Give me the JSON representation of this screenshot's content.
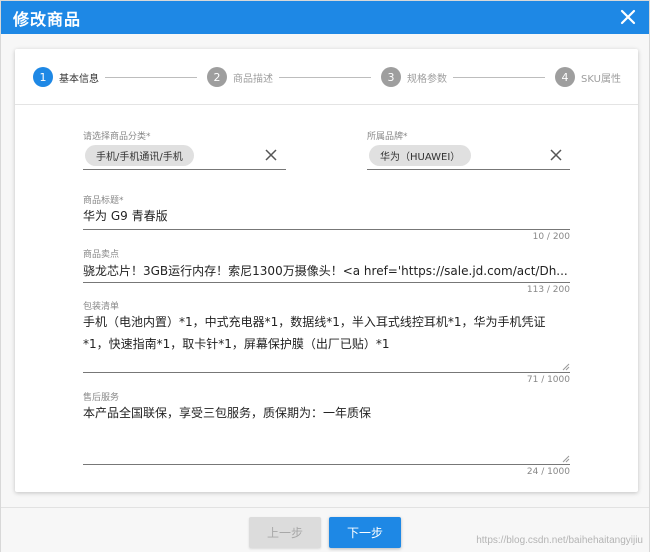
{
  "dialog": {
    "title": "修改商品"
  },
  "stepper": {
    "steps": [
      {
        "number": "1",
        "label": "基本信息"
      },
      {
        "number": "2",
        "label": "商品描述"
      },
      {
        "number": "3",
        "label": "规格参数"
      },
      {
        "number": "4",
        "label": "SKU属性"
      }
    ],
    "active_step": 1
  },
  "form": {
    "category": {
      "label": "请选择商品分类*",
      "value": "手机/手机通讯/手机"
    },
    "brand": {
      "label": "所属品牌*",
      "value": "华为（HUAWEI）"
    },
    "title": {
      "label": "商品标题*",
      "value": "华为 G9 青春版",
      "counter": "10 / 200"
    },
    "selling_point": {
      "label": "商品卖点",
      "value": "骁龙芯片！3GB运行内存！索尼1300万摄像头！<a href='https://sale.jd.com/act/Dh...",
      "counter": "113 / 200"
    },
    "package_list": {
      "label": "包装清单",
      "value": "手机（电池内置）*1，中式充电器*1，数据线*1，半入耳式线控耳机*1，华为手机凭证*1，快速指南*1，取卡针*1，屏幕保护膜（出厂已贴）*1",
      "counter": "71 / 1000"
    },
    "after_service": {
      "label": "售后服务",
      "value": "本产品全国联保，享受三包服务，质保期为：一年质保",
      "counter": "24 / 1000"
    }
  },
  "footer": {
    "prev_label": "上一步",
    "next_label": "下一步"
  },
  "watermark": "https://blog.csdn.net/baihehaitangyijiu",
  "colors": {
    "primary": "#1e88e5",
    "inactive": "#9e9e9e",
    "chip": "#e0e0e0"
  }
}
